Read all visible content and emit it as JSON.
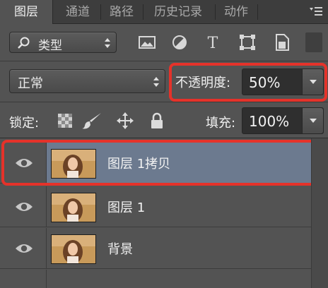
{
  "tabs": [
    {
      "label": "图层",
      "active": true
    },
    {
      "label": "通道",
      "active": false
    },
    {
      "label": "路径",
      "active": false
    },
    {
      "label": "历史记录",
      "active": false
    },
    {
      "label": "动作",
      "active": false
    }
  ],
  "filter": {
    "kind_label": "类型",
    "icons": [
      "image-filter-icon",
      "adjustment-filter-icon",
      "type-filter-icon",
      "shape-filter-icon",
      "smart-object-filter-icon"
    ]
  },
  "blend": {
    "mode": "正常",
    "opacity_label": "不透明度:",
    "opacity_value": "50%"
  },
  "lock": {
    "label": "锁定:",
    "icons": [
      "lock-transparent-pixels-icon",
      "lock-image-pixels-icon",
      "lock-position-icon",
      "lock-all-icon"
    ],
    "fill_label": "填充:",
    "fill_value": "100%"
  },
  "layers": [
    {
      "name": "图层 1拷贝",
      "selected": true,
      "visible": true
    },
    {
      "name": "图层 1",
      "selected": false,
      "visible": true
    },
    {
      "name": "背景",
      "selected": false,
      "visible": true
    }
  ],
  "colors": {
    "highlight": "#e5322a",
    "selected_layer": "#6c7a8f",
    "panel": "#535353"
  }
}
